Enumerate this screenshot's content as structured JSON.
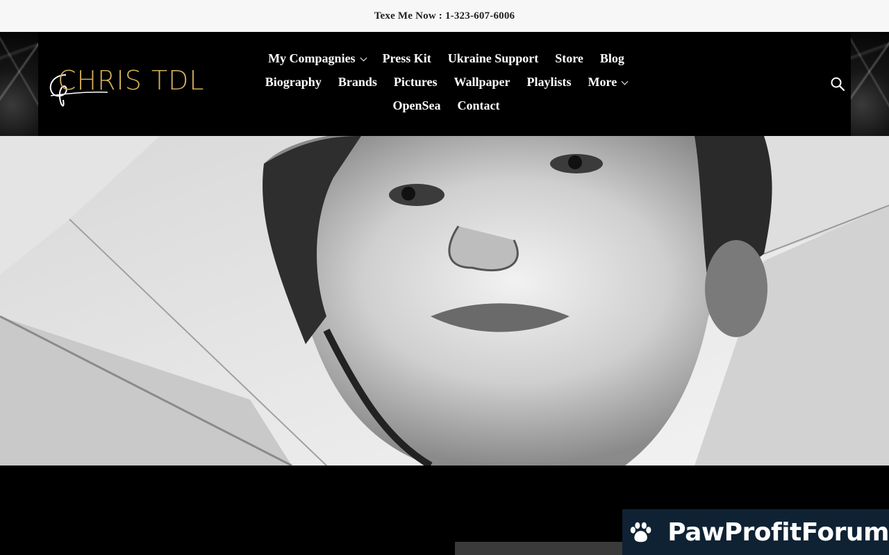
{
  "topbar": {
    "text": "Texe Me Now : 1-323-607-6006"
  },
  "logo": {
    "text": "CHRIS TDL",
    "color": "#d4ae5a"
  },
  "nav": {
    "rows": [
      [
        {
          "label": "My Compagnies",
          "dropdown": true
        },
        {
          "label": "Press Kit"
        },
        {
          "label": "Ukraine Support"
        },
        {
          "label": "Store"
        },
        {
          "label": "Blog"
        }
      ],
      [
        {
          "label": "Biography"
        },
        {
          "label": "Brands"
        },
        {
          "label": "Pictures"
        },
        {
          "label": "Wallpaper"
        },
        {
          "label": "Playlists"
        },
        {
          "label": "More",
          "dropdown": true
        }
      ],
      [
        {
          "label": "OpenSea"
        },
        {
          "label": "Contact"
        }
      ]
    ]
  },
  "search": {
    "icon": "search-icon"
  },
  "hero": {
    "image": "portrait-image"
  },
  "badge": {
    "text": "PawProfitForum",
    "icon": "paw-icon",
    "bg": "#0f2233"
  }
}
